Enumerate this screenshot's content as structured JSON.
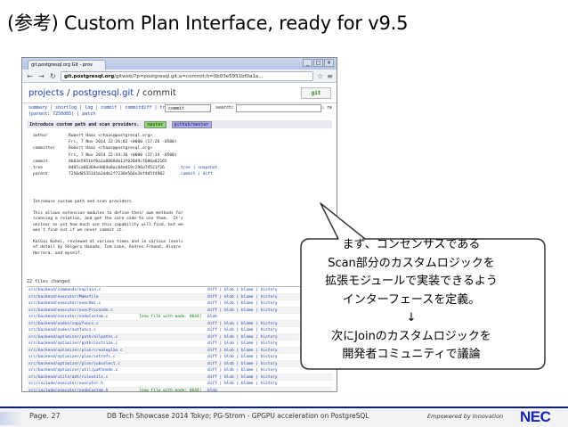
{
  "slide": {
    "title": "(参考) Custom Plan Interface, ready for v9.5"
  },
  "browser": {
    "tab_title": "git.postgresql.org Git - prov",
    "url_domain": "git.postgresql.org",
    "url_rest": "/gitweb/?p=postgresql.git;a=commit;h=0b03e5951bf0a1a...",
    "window_buttons": [
      "_",
      "□",
      "×"
    ]
  },
  "gitweb": {
    "path_projects": "projects",
    "path_repo": "postgresql.git",
    "path_view": "commit",
    "logo": "git",
    "nav_links": "summary | shortlog | log | commit | commitdiff | tree",
    "nav_links2": "(parent: 7250d85) | patch",
    "commit_select": "commit",
    "search_label": "search:",
    "re_label": "re",
    "intro": "Introduce custom path and scan providers.",
    "tags": [
      "master",
      "github/master"
    ],
    "meta": [
      {
        "key": "author",
        "val": "Robert Haas <rhaas@postgresql.org>",
        "link": ""
      },
      {
        "key": "",
        "val": "Fri, 7 Nov 2014 22:26:02 +0000 (17:26 -0500)",
        "link": ""
      },
      {
        "key": "committer",
        "val": "Robert Haas <rhaas@postgresql.org>",
        "link": ""
      },
      {
        "key": "",
        "val": "Fri, 7 Nov 2014 22:34:36 +0000 (17:34 -0500)",
        "link": ""
      },
      {
        "key": "commit",
        "val": "0b03e5951bf0a1a8868db13f02049cf686a82165",
        "link": ""
      },
      {
        "key": "tree",
        "val": "0485ca66369edd84a8ac84ed19c296a74521f26",
        "link": "tree | snapshot"
      },
      {
        "key": "parent",
        "val": "7250d85351d1b2ddb2f7230e566e2bf4d5f4902",
        "link": "commit | diff"
      }
    ],
    "message": "Introduce custom path and scan providers.\n\nThis allows extension modules to define their own methods for\nscanning a relation, and get the core code to use them.  It's\nunclear as yet how much use this capability will find, but we\nwon't find out if we never commit it.\n\nKaiGai Kohei, reviewed at various times and in various levels\nof detail by Shigeru Hanada, Tom Lane, Andres Freund, Alvaro\nHerrera, and myself.",
    "files_changed": "22 files changed",
    "files": [
      {
        "name": "src/backend/commands/explain.c",
        "new": "",
        "links": "diff | blob | blame | history"
      },
      {
        "name": "src/backend/executor/Makefile",
        "new": "",
        "links": "diff | blob | blame | history"
      },
      {
        "name": "src/backend/executor/execAmi.c",
        "new": "",
        "links": "diff | blob | blame | history"
      },
      {
        "name": "src/backend/executor/execProcnode.c",
        "new": "",
        "links": "diff | blob | blame | history"
      },
      {
        "name": "src/backend/executor/nodeCustom.c",
        "new": "[new file with mode: 0644]",
        "links": "blob"
      },
      {
        "name": "src/backend/nodes/copyfuncs.c",
        "new": "",
        "links": "diff | blob | blame | history"
      },
      {
        "name": "src/backend/nodes/outfuncs.c",
        "new": "",
        "links": "diff | blob | blame | history"
      },
      {
        "name": "src/backend/optimizer/path/allpaths.c",
        "new": "",
        "links": "diff | blob | blame | history"
      },
      {
        "name": "src/backend/optimizer/path/costsize.c",
        "new": "",
        "links": "diff | blob | blame | history"
      },
      {
        "name": "src/backend/optimizer/plan/createplan.c",
        "new": "",
        "links": "diff | blob | blame | history"
      },
      {
        "name": "src/backend/optimizer/plan/setrefs.c",
        "new": "",
        "links": "diff | blob | blame | history"
      },
      {
        "name": "src/backend/optimizer/plan/subselect.c",
        "new": "",
        "links": "diff | blob | blame | history"
      },
      {
        "name": "src/backend/optimizer/util/pathnode.c",
        "new": "",
        "links": "diff | blob | blame | history"
      },
      {
        "name": "src/backend/utils/adt/ruleutils.c",
        "new": "",
        "links": "diff | blob | blame | history"
      },
      {
        "name": "src/include/executor/executor.h",
        "new": "",
        "links": "diff | blob | blame | history"
      },
      {
        "name": "src/include/executor/nodeCustom.h",
        "new": "[new file with mode: 0644]",
        "links": "blob"
      }
    ]
  },
  "callout": {
    "lines": [
      "まず、コンセンサスである",
      "Scan部分のカスタムロジックを",
      "拡張モジュールで実装できるよう",
      "インターフェースを定義。",
      "↓",
      "次にJoinのカスタムロジックを",
      "開発者コミュニティで議論"
    ]
  },
  "footer": {
    "page": "Page. 27",
    "caption": "DB Tech Showcase 2014 Tokyo; PG-Strom - GPGPU acceleration on PostgreSQL",
    "tagline": "Empowered by Innovation",
    "logo": "NEC"
  }
}
